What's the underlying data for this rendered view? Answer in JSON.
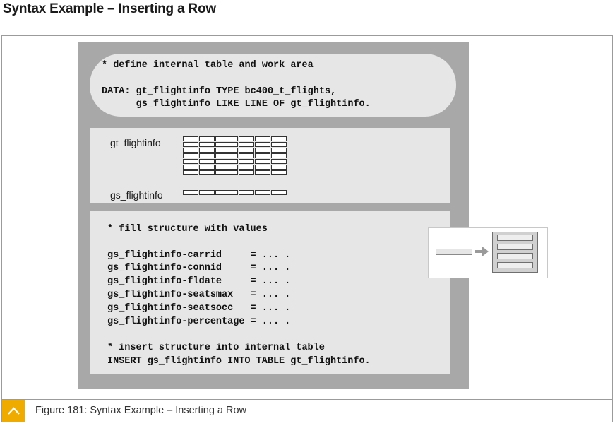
{
  "page_title": "Syntax Example – Inserting a Row",
  "declare_block": {
    "comment": "* define internal table and work area",
    "line1": "DATA: gt_flightinfo TYPE bc400_t_flights,",
    "line2": "      gs_flightinfo LIKE LINE OF gt_flightinfo."
  },
  "variables": {
    "table_label": "gt_flightinfo",
    "structure_label": "gs_flightinfo"
  },
  "fill_block": {
    "comment1": "* fill structure with values",
    "assignments": [
      "gs_flightinfo-carrid     = ... .",
      "gs_flightinfo-connid     = ... .",
      "gs_flightinfo-fldate     = ... .",
      "gs_flightinfo-seatsmax   = ... .",
      "gs_flightinfo-seatsocc   = ... .",
      "gs_flightinfo-percentage = ... ."
    ],
    "comment2": "* insert structure into internal table",
    "statement": "INSERT gs_flightinfo INTO TABLE gt_flightinfo."
  },
  "caption": "Figure 181: Syntax Example – Inserting a Row",
  "colors": {
    "accent": "#f0ab00",
    "panel": "#a8a8a8",
    "box": "#e6e6e6"
  },
  "icons": {
    "caption_icon": "chevron-up-icon"
  }
}
